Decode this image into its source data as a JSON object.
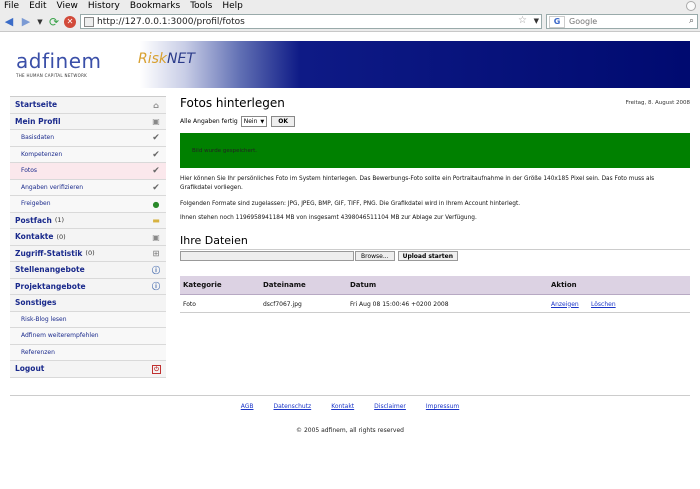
{
  "browser": {
    "menu": [
      "File",
      "Edit",
      "View",
      "History",
      "Bookmarks",
      "Tools",
      "Help"
    ],
    "url": "http://127.0.0.1:3000/profil/fotos",
    "search_placeholder": "Google",
    "search_engine_glyph": "G"
  },
  "banner": {
    "logo": "adfinem",
    "logo_tagline": "THE HUMAN CAPITAL NETWORK",
    "brand_a": "Risk",
    "brand_b": "NET"
  },
  "sidebar": {
    "startseite": "Startseite",
    "mein_profil": "Mein Profil",
    "sub_profil": [
      "Basisdaten",
      "Kompetenzen",
      "Fotos",
      "Angaben verifizieren",
      "Freigeben"
    ],
    "postfach": "Postfach",
    "postfach_count": "(1)",
    "kontakte": "Kontakte",
    "kontakte_count": "(0)",
    "zugriff": "Zugriff-Statistik",
    "zugriff_count": "(0)",
    "stellenangebote": "Stellenangebote",
    "projektangebote": "Projektangebote",
    "sonstiges": "Sonstiges",
    "sub_sonstiges": [
      "Risk-Blog lesen",
      "Adfinem weiterempfehlen",
      "Referenzen"
    ],
    "logout": "Logout"
  },
  "content": {
    "title": "Fotos hinterlegen",
    "date": "Freitag, 8. August 2008",
    "fertig_label": "Alle Angaben fertig",
    "fertig_value": "Nein",
    "ok_label": "OK",
    "message": "Bild wurde gespeichert.",
    "para1": "Hier können Sie Ihr persönliches Foto im System hinterlegen. Das Bewerbungs-Foto sollte ein Portraitaufnahme in der Größe 140x185 Pixel sein. Das Foto muss als Grafikdatei vorliegen.",
    "para2": "Folgenden Formate sind zugelassen: JPG, JPEG, BMP, GIF, TIFF, PNG. Die Grafikdatei wird in Ihrem Account hinterlegt.",
    "para3": "Ihnen stehen noch 1196958941184 MB von insgesamt 4398046511104 MB zur Ablage zur Verfügung.",
    "files_title": "Ihre Dateien",
    "browse_label": "Browse...",
    "upload_label": "Upload starten",
    "table": {
      "headers": [
        "Kategorie",
        "Dateiname",
        "Datum",
        "Aktion"
      ],
      "rows": [
        {
          "kategorie": "Foto",
          "dateiname": "dscf7067.jpg",
          "datum": "Fri Aug 08 15:00:46 +0200 2008",
          "anzeigen": "Anzeigen",
          "loeschen": "Löschen"
        }
      ]
    }
  },
  "footer": {
    "links": [
      "AGB",
      "Datenschutz",
      "Kontakt",
      "Disclaimer",
      "Impressum"
    ],
    "copyright": "© 2005 adfinem, all rights reserved"
  },
  "colors": {
    "success_banner": "#008000",
    "table_header": "#dcd2e3",
    "nav_text": "#1a2a8c",
    "banner_dark": "#000a70"
  }
}
